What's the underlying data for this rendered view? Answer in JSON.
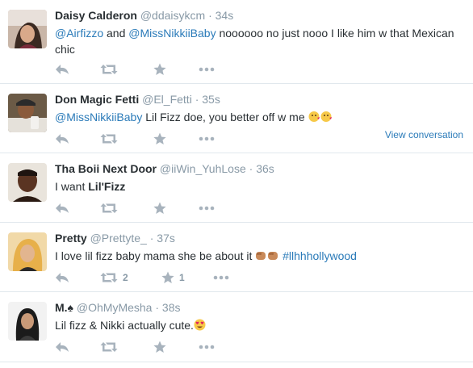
{
  "tweets": [
    {
      "fullname": "Daisy Calderon",
      "username": "@ddaisykcm",
      "separator": "·",
      "time": "34s",
      "mention1": "@Airfizzo",
      "and": " and ",
      "mention2": "@MissNikkiiBaby",
      "text": " noooooo no just nooo I like him w that Mexican chic"
    },
    {
      "fullname": "Don Magic Fetti",
      "username": "@El_Fetti",
      "separator": "·",
      "time": "35s",
      "mention1": "@MissNikkiiBaby",
      "text": " Lil Fizz doe, you better off w me ",
      "emoji": "kissing-face-emoji x2",
      "view_conversation": "View conversation"
    },
    {
      "fullname": "Tha Boii Next Door",
      "username": "@iiWin_YuhLose",
      "separator": "·",
      "time": "36s",
      "text_prefix": "I want ",
      "text_bold": "Lil'Fizz"
    },
    {
      "fullname": "Pretty",
      "username": "@Prettyte_",
      "separator": "·",
      "time": "37s",
      "text": "I love lil fizz baby mama she be about it ",
      "emoji": "punch-emoji x2",
      "hashtag": "#llhhhollywood",
      "retweet_count": "2",
      "favorite_count": "1"
    },
    {
      "fullname": "M.♠",
      "username": "@OhMyMesha",
      "separator": "·",
      "time": "38s",
      "text": "Lil fizz & Nikki actually cute.",
      "emoji": "heart-eyes-emoji"
    }
  ],
  "icons": {
    "reply": "reply-icon",
    "retweet": "retweet-icon",
    "favorite": "star-icon",
    "more": "more-icon"
  },
  "colors": {
    "link": "#2b7bb9",
    "muted": "#8899a6",
    "action": "#a8b3bd",
    "divider": "#e1e8ed"
  }
}
